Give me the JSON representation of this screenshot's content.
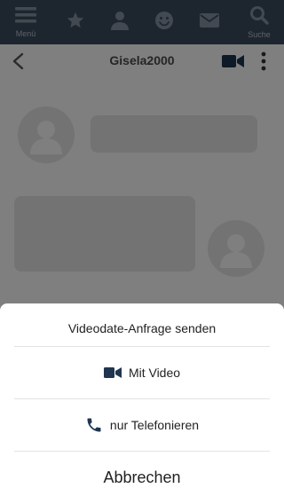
{
  "nav": {
    "menu_label": "Menü",
    "search_label": "Suche",
    "icons": [
      "menu-icon",
      "star-icon",
      "user-icon",
      "smile-icon",
      "mail-icon",
      "search-icon"
    ],
    "color": "#3a4d5e"
  },
  "chat": {
    "partner_name": "Gisela2000"
  },
  "sheet": {
    "title": "Videodate-Anfrage senden",
    "option_video": "Mit Video",
    "option_phone": "nur Telefonieren",
    "cancel": "Abbrechen",
    "icon_color": "#1f3550"
  }
}
